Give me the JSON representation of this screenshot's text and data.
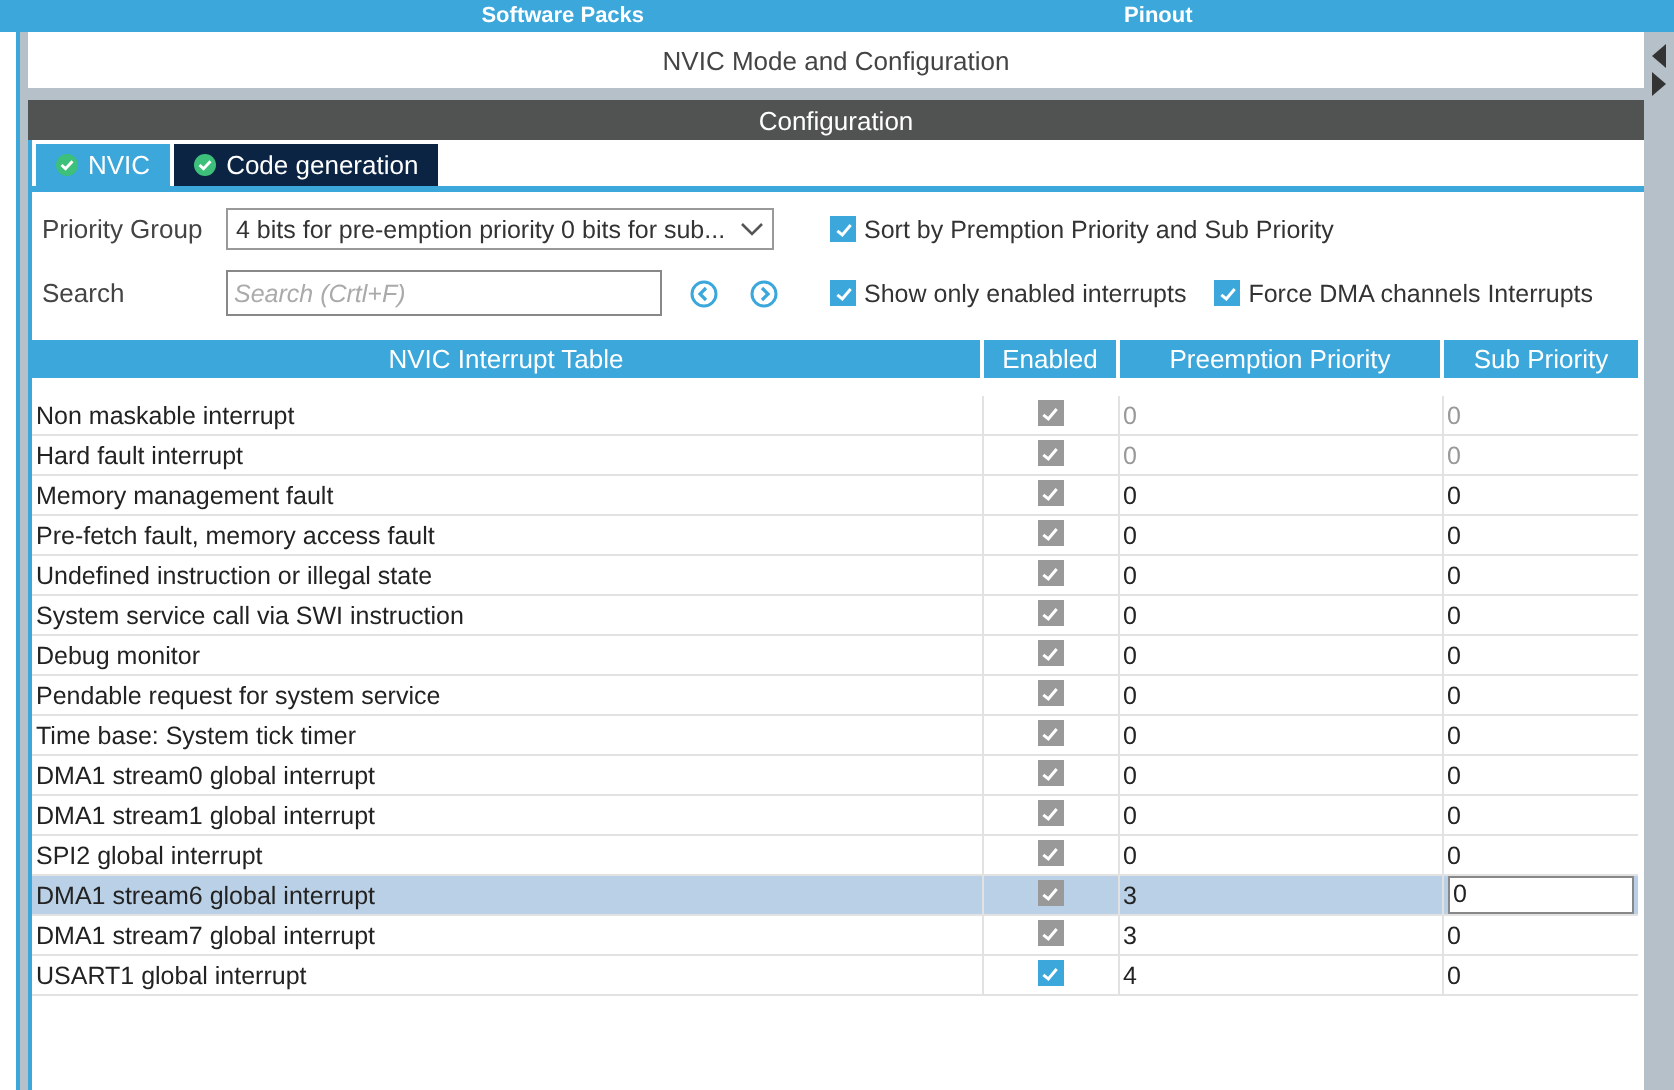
{
  "top_bar": {
    "items": [
      "Software Packs",
      "Pinout"
    ]
  },
  "panel_title": "NVIC Mode and Configuration",
  "section_title": "Configuration",
  "tabs": [
    {
      "label": "NVIC",
      "selected": true
    },
    {
      "label": "Code generation",
      "selected": false
    }
  ],
  "priority_group": {
    "label": "Priority Group",
    "value": "4 bits for pre-emption priority 0 bits for sub..."
  },
  "search": {
    "label": "Search",
    "placeholder": "Search (Crtl+F)"
  },
  "options": [
    {
      "label": "Sort by Premption Priority and Sub Priority",
      "checked": true
    },
    {
      "label": "Show only enabled interrupts",
      "checked": true
    },
    {
      "label": "Force DMA channels Interrupts",
      "checked": true
    }
  ],
  "table": {
    "columns": [
      "NVIC Interrupt Table",
      "Enabled",
      "Preemption Priority",
      "Sub Priority"
    ],
    "rows": [
      {
        "name": "Non maskable interrupt",
        "enabled": true,
        "disabled": true,
        "priority_locked": true,
        "preemption": "0",
        "sub": "0",
        "selected": false
      },
      {
        "name": "Hard fault interrupt",
        "enabled": true,
        "disabled": true,
        "priority_locked": true,
        "preemption": "0",
        "sub": "0",
        "selected": false
      },
      {
        "name": "Memory management fault",
        "enabled": true,
        "disabled": true,
        "priority_locked": false,
        "preemption": "0",
        "sub": "0",
        "selected": false
      },
      {
        "name": "Pre-fetch fault, memory access fault",
        "enabled": true,
        "disabled": true,
        "priority_locked": false,
        "preemption": "0",
        "sub": "0",
        "selected": false
      },
      {
        "name": "Undefined instruction or illegal state",
        "enabled": true,
        "disabled": true,
        "priority_locked": false,
        "preemption": "0",
        "sub": "0",
        "selected": false
      },
      {
        "name": "System service call via SWI instruction",
        "enabled": true,
        "disabled": true,
        "priority_locked": false,
        "preemption": "0",
        "sub": "0",
        "selected": false
      },
      {
        "name": "Debug monitor",
        "enabled": true,
        "disabled": true,
        "priority_locked": false,
        "preemption": "0",
        "sub": "0",
        "selected": false
      },
      {
        "name": "Pendable request for system service",
        "enabled": true,
        "disabled": true,
        "priority_locked": false,
        "preemption": "0",
        "sub": "0",
        "selected": false
      },
      {
        "name": "Time base: System tick timer",
        "enabled": true,
        "disabled": true,
        "priority_locked": false,
        "preemption": "0",
        "sub": "0",
        "selected": false
      },
      {
        "name": "DMA1 stream0 global interrupt",
        "enabled": true,
        "disabled": true,
        "priority_locked": false,
        "preemption": "0",
        "sub": "0",
        "selected": false
      },
      {
        "name": "DMA1 stream1 global interrupt",
        "enabled": true,
        "disabled": true,
        "priority_locked": false,
        "preemption": "0",
        "sub": "0",
        "selected": false
      },
      {
        "name": "SPI2 global interrupt",
        "enabled": true,
        "disabled": true,
        "priority_locked": false,
        "preemption": "0",
        "sub": "0",
        "selected": false
      },
      {
        "name": "DMA1 stream6 global interrupt",
        "enabled": true,
        "disabled": true,
        "priority_locked": false,
        "preemption": "3",
        "sub": "0",
        "selected": true
      },
      {
        "name": "DMA1 stream7 global interrupt",
        "enabled": true,
        "disabled": true,
        "priority_locked": false,
        "preemption": "3",
        "sub": "0",
        "selected": false
      },
      {
        "name": "USART1 global interrupt",
        "enabled": true,
        "disabled": false,
        "priority_locked": false,
        "preemption": "4",
        "sub": "0",
        "selected": false
      }
    ]
  }
}
